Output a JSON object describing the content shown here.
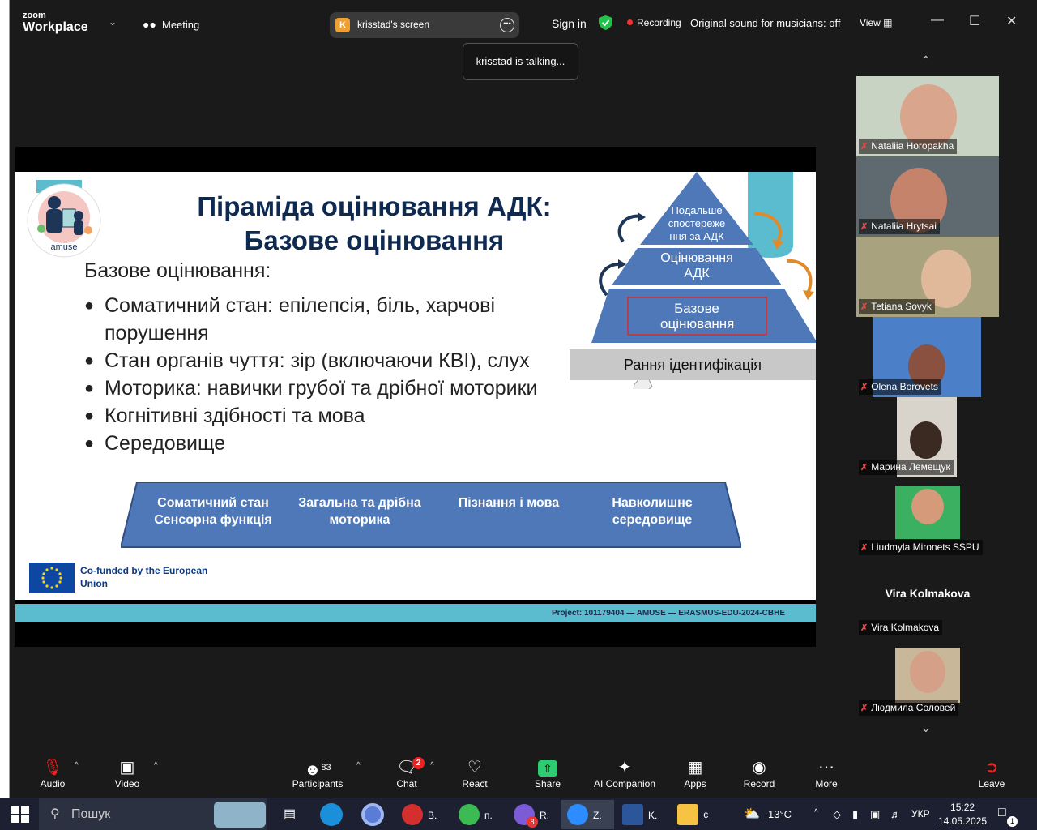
{
  "app": {
    "brand_small": "zoom",
    "brand_large": "Workplace",
    "meeting_label": "Meeting"
  },
  "screen_pill": {
    "initial": "K",
    "title": "krisstad's screen"
  },
  "top": {
    "sign_in": "Sign in",
    "recording": "Recording",
    "original_sound": "Original sound for musicians: off",
    "view": "View"
  },
  "talking": "krisstad is talking...",
  "slide": {
    "title1": "Піраміда оцінювання АДК:",
    "title2": "Базове оцінювання",
    "heading": "Базове оцінювання:",
    "bullets": [
      "Соматичний стан: епілепсія, біль, харчові порушення",
      "Стан органів чуття: зір (включаючи КВІ), слух",
      "Моторика: навички грубої та дрібної моторики",
      "Когнітивні здібності та мова",
      "Середовище"
    ],
    "pyramid_top": "Подальше спостереже ння за АДК",
    "pyramid_mid": "Оцінювання АДК",
    "pyramid_base": "Базове оцінювання",
    "early_id": "Рання ідентифікація",
    "trap": [
      "Соматичний стан Сенсорна функція",
      "Загальна та дрібна моторика",
      "Пізнання і мова",
      "Навколишнє середовище"
    ],
    "logo_text": "amuse",
    "cofund": "Co-funded by the European Union",
    "footer": "Project: 101179404 — AMUSE — ERASMUS-EDU-2024-CBHE"
  },
  "participants": [
    {
      "name": "Nataliia Horopakha",
      "muted": true
    },
    {
      "name": "Nataliia Hrytsai",
      "muted": true
    },
    {
      "name": "Tetiana Sovyk",
      "muted": true
    },
    {
      "name": "Olena Borovets",
      "muted": true
    },
    {
      "name": "Марина Лемещук",
      "muted": true
    },
    {
      "name": "Liudmyla Mironets SSPU",
      "muted": true
    },
    {
      "name": "Vira Kolmakova",
      "muted": true,
      "no_video": true
    },
    {
      "name": "Людмила Соловей",
      "muted": true
    }
  ],
  "toolbar": {
    "audio": "Audio",
    "video": "Video",
    "participants": "Participants",
    "participants_count": "83",
    "chat": "Chat",
    "chat_badge": "2",
    "react": "React",
    "share": "Share",
    "ai": "AI Companion",
    "apps": "Apps",
    "record": "Record",
    "more": "More",
    "leave": "Leave"
  },
  "taskbar": {
    "search_placeholder": "Пошук",
    "apps": [
      {
        "label": "В.",
        "color": "#d32f2f"
      },
      {
        "label": "п.",
        "color": "#3cba54"
      },
      {
        "label": "R.",
        "color": "#7b5cd6",
        "badge": "8"
      },
      {
        "label": "Z.",
        "color": "#2d8cff"
      },
      {
        "label": "K.",
        "color": "#2b579a"
      },
      {
        "label": "¢",
        "color": "#f6c343"
      }
    ],
    "temp": "13°C",
    "lang": "УКР",
    "time": "15:22",
    "date": "14.05.2025",
    "notif": "1"
  },
  "colors": {
    "slide_blue": "#4f78b8",
    "title_navy": "#0f2a50",
    "teal": "#5bbcd0",
    "share_green": "#2ecc71",
    "leave_red": "#e22"
  }
}
